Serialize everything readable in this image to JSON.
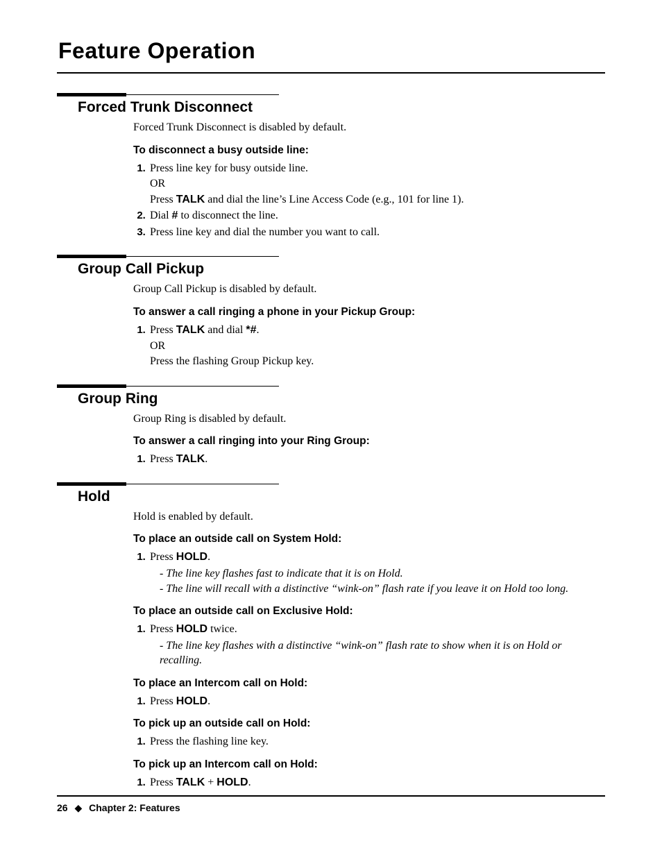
{
  "page_title": "Feature Operation",
  "footer": {
    "page_no": "26",
    "chapter": "Chapter 2: Features"
  },
  "sections": [
    {
      "heading": "Forced Trunk Disconnect",
      "intro": "Forced Trunk Disconnect is disabled by default.",
      "blocks": [
        {
          "sub": "To disconnect a busy outside line:",
          "steps": [
            {
              "parts": [
                "Press line key for busy outside line.",
                "OR",
                "Press |TALK| and dial the line’s Line Access Code (e.g., 101 for line 1)."
              ]
            },
            {
              "parts": [
                "Dial |#| to disconnect the line."
              ]
            },
            {
              "parts": [
                "Press line key and dial the number you want to call."
              ]
            }
          ]
        }
      ]
    },
    {
      "heading": "Group Call Pickup",
      "intro": "Group Call Pickup is disabled by default.",
      "blocks": [
        {
          "sub": "To answer a call ringing a phone in your Pickup Group:",
          "steps": [
            {
              "parts": [
                "Press |TALK| and dial |*#|.",
                "OR",
                "Press the flashing Group Pickup key."
              ]
            }
          ]
        }
      ]
    },
    {
      "heading": "Group Ring",
      "intro": "Group Ring is disabled by default.",
      "blocks": [
        {
          "sub": "To answer a call ringing into your Ring Group:",
          "steps": [
            {
              "parts": [
                "Press |TALK|."
              ]
            }
          ]
        }
      ]
    },
    {
      "heading": "Hold",
      "intro": "Hold is enabled by default.",
      "blocks": [
        {
          "sub": "To place an outside call on System Hold:",
          "steps": [
            {
              "parts": [
                "Press |HOLD|."
              ],
              "notes": [
                "The line key flashes fast to indicate that it is on Hold.",
                "The line will recall with a distinctive “wink-on” flash rate if you leave it on Hold too long."
              ]
            }
          ]
        },
        {
          "sub": "To place an outside call on Exclusive Hold:",
          "steps": [
            {
              "parts": [
                "Press |HOLD| twice."
              ],
              "notes": [
                "The line key flashes with a distinctive “wink-on” flash rate to show when it is on Hold or recalling."
              ]
            }
          ]
        },
        {
          "sub": "To place an Intercom call on Hold:",
          "steps": [
            {
              "parts": [
                "Press |HOLD|."
              ]
            }
          ]
        },
        {
          "sub": "To pick up an outside call on Hold:",
          "steps": [
            {
              "parts": [
                "Press the flashing line key."
              ]
            }
          ]
        },
        {
          "sub": "To pick up an Intercom call on Hold:",
          "steps": [
            {
              "parts": [
                "Press |TALK| + |HOLD|."
              ]
            }
          ]
        }
      ]
    }
  ]
}
